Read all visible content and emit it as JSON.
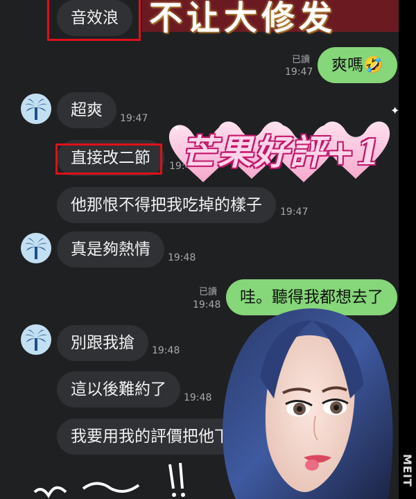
{
  "banner": {
    "text": "不让大修发"
  },
  "sticker": {
    "text": "芒果好評+1"
  },
  "watermark": "MEIT",
  "messages": [
    {
      "text": "音效浪"
    },
    {
      "text": "爽嗎🤣",
      "read": "已讀",
      "time": "19:47"
    },
    {
      "text": "超爽",
      "time": "19:47"
    },
    {
      "text": "直接改二節",
      "time": "19:47"
    },
    {
      "text": "他那恨不得把我吃掉的樣子",
      "time": "19:47"
    },
    {
      "text": "真是夠熱情",
      "time": "19:48"
    },
    {
      "text": "哇。聽得我都想去了",
      "read": "已讀",
      "time": "19:48"
    },
    {
      "text": "別跟我搶",
      "time": "19:48"
    },
    {
      "text": "這以後難約了",
      "time": "19:48"
    },
    {
      "text": "我要用我的評價把他下"
    }
  ]
}
